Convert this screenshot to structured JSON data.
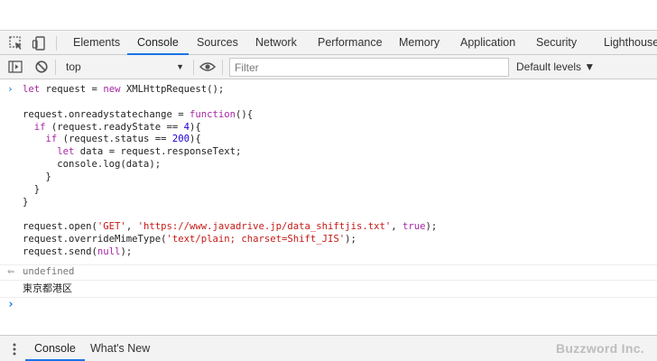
{
  "tabs": [
    {
      "label": "Elements"
    },
    {
      "label": "Console",
      "active": true
    },
    {
      "label": "Sources"
    },
    {
      "label": "Network"
    },
    {
      "label": "Performance"
    },
    {
      "label": "Memory"
    },
    {
      "label": "Application"
    },
    {
      "label": "Security"
    },
    {
      "label": "Lighthouse"
    }
  ],
  "toolbar": {
    "context": "top",
    "filter_placeholder": "Filter",
    "levels": "Default levels ▼"
  },
  "console": {
    "input_lines": [
      "let request = new XMLHttpRequest();",
      "",
      "request.onreadystatechange = function(){",
      "  if (request.readyState == 4){",
      "    if (request.status == 200){",
      "      let data = request.responseText;",
      "      console.log(data);",
      "    }",
      "  }",
      "}",
      "",
      "request.open('GET', 'https://www.javadrive.jp/data_shiftjis.txt', true);",
      "request.overrideMimeType('text/plain; charset=Shift_JIS');",
      "request.send(null);"
    ],
    "return_value": "undefined",
    "log_output": "東京都港区"
  },
  "drawer": {
    "tabs": [
      {
        "label": "Console",
        "active": true
      },
      {
        "label": "What's New"
      }
    ],
    "watermark": "Buzzword Inc."
  },
  "colors": {
    "accent": "#1a73e8",
    "keyword": "#a626a4",
    "string": "#c41a16",
    "number": "#1c00cf"
  }
}
